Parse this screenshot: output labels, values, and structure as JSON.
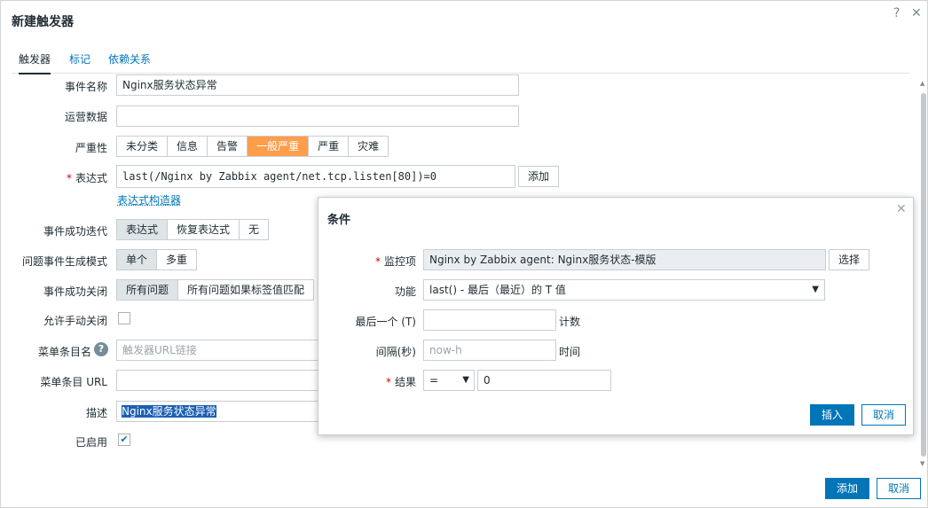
{
  "dialog": {
    "title": "新建触发器",
    "help_icon": "?",
    "close_icon": "✕",
    "tabs": [
      {
        "label": "触发器",
        "active": true
      },
      {
        "label": "标记",
        "active": false
      },
      {
        "label": "依赖关系",
        "active": false
      }
    ],
    "form": {
      "event_name": {
        "label": "事件名称",
        "value": "Nginx服务状态异常"
      },
      "opdata": {
        "label": "运营数据",
        "value": ""
      },
      "severity": {
        "label": "严重性",
        "options": [
          "未分类",
          "信息",
          "告警",
          "一般严重",
          "严重",
          "灾难"
        ],
        "selected": "一般严重"
      },
      "expression": {
        "label": "表达式",
        "value": "last(/Nginx by Zabbix agent/net.tcp.listen[80])=0",
        "add_button": "添加",
        "builder_link": "表达式构造器"
      },
      "ok_event_gen": {
        "label": "事件成功迭代",
        "options": [
          "表达式",
          "恢复表达式",
          "无"
        ],
        "selected": "表达式"
      },
      "problem_mode": {
        "label": "问题事件生成模式",
        "options": [
          "单个",
          "多重"
        ],
        "selected": "单个"
      },
      "ok_close": {
        "label": "事件成功关闭",
        "options": [
          "所有问题",
          "所有问题如果标签值匹配"
        ],
        "selected": "所有问题"
      },
      "manual_close": {
        "label": "允许手动关闭",
        "checked": false
      },
      "menu_name": {
        "label": "菜单条目名",
        "placeholder": "触发器URL链接",
        "help_icon": "?"
      },
      "menu_url": {
        "label": "菜单条目 URL",
        "value": ""
      },
      "description": {
        "label": "描述",
        "value": "Nginx服务状态异常"
      },
      "enabled": {
        "label": "已启用",
        "checked": true,
        "check_mark": "✔"
      }
    },
    "footer": {
      "add": "添加",
      "cancel": "取消"
    }
  },
  "condition": {
    "title": "条件",
    "close_icon": "✕",
    "item": {
      "label": "监控项",
      "value": "Nginx by Zabbix agent: Nginx服务状态-模版",
      "select_button": "选择"
    },
    "function": {
      "label": "功能",
      "value": "last() - 最后（最近）的 T 值"
    },
    "last_of": {
      "label": "最后一个 (T)",
      "value": "",
      "unit": "计数"
    },
    "interval": {
      "label": "间隔(秒)",
      "placeholder": "now-h",
      "unit": "时间"
    },
    "result": {
      "label": "结果",
      "operator": "=",
      "value": "0"
    },
    "insert": "插入",
    "cancel": "取消"
  },
  "colors": {
    "accent": "#0275b8",
    "severity_selected": "#ff9e4a",
    "required": "#d40000"
  }
}
